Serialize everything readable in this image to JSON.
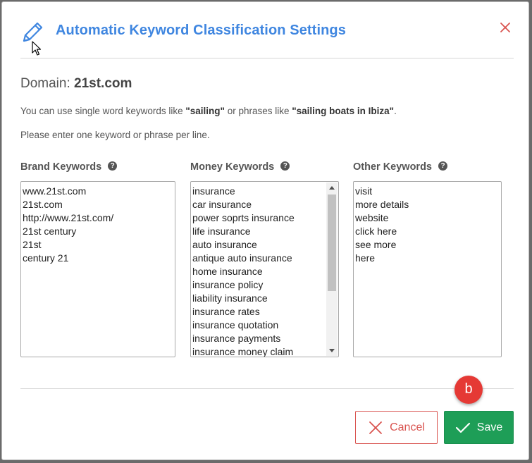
{
  "dialog": {
    "title": "Automatic Keyword Classification Settings",
    "domain_label": "Domain:",
    "domain_value": "21st.com",
    "help_line1_prefix": "You can use single word keywords like ",
    "help_line1_ex1": "\"sailing\"",
    "help_line1_mid": " or phrases like ",
    "help_line1_ex2": "\"sailing boats in Ibiza\"",
    "help_line1_suffix": ".",
    "help_line2": "Please enter one keyword or phrase per line."
  },
  "columns": [
    {
      "label": "Brand Keywords",
      "keywords": [
        "www.21st.com",
        "21st.com",
        "http://www.21st.com/",
        "21st century",
        "21st",
        "century 21"
      ]
    },
    {
      "label": "Money Keywords",
      "keywords": [
        "insurance",
        "car insurance",
        "power soprts insurance",
        "life insurance",
        "auto insurance",
        "antique auto insurance",
        "home insurance",
        "insurance policy",
        "liability insurance",
        "insurance rates",
        "insurance quotation",
        "insurance payments",
        "insurance money claim"
      ]
    },
    {
      "label": "Other Keywords",
      "keywords": [
        "visit",
        "more details",
        "website",
        "click here",
        "see more",
        "here"
      ]
    }
  ],
  "help_icon_glyph": "?",
  "badge_label": "b",
  "buttons": {
    "cancel": "Cancel",
    "save": "Save"
  },
  "colors": {
    "accent": "#3f86e0",
    "save": "#1e9e57",
    "cancel": "#d9534f",
    "badge": "#e53935"
  },
  "icons": [
    "pencil-icon",
    "cursor-icon",
    "close-icon",
    "help-icon",
    "x-icon",
    "check-icon"
  ]
}
